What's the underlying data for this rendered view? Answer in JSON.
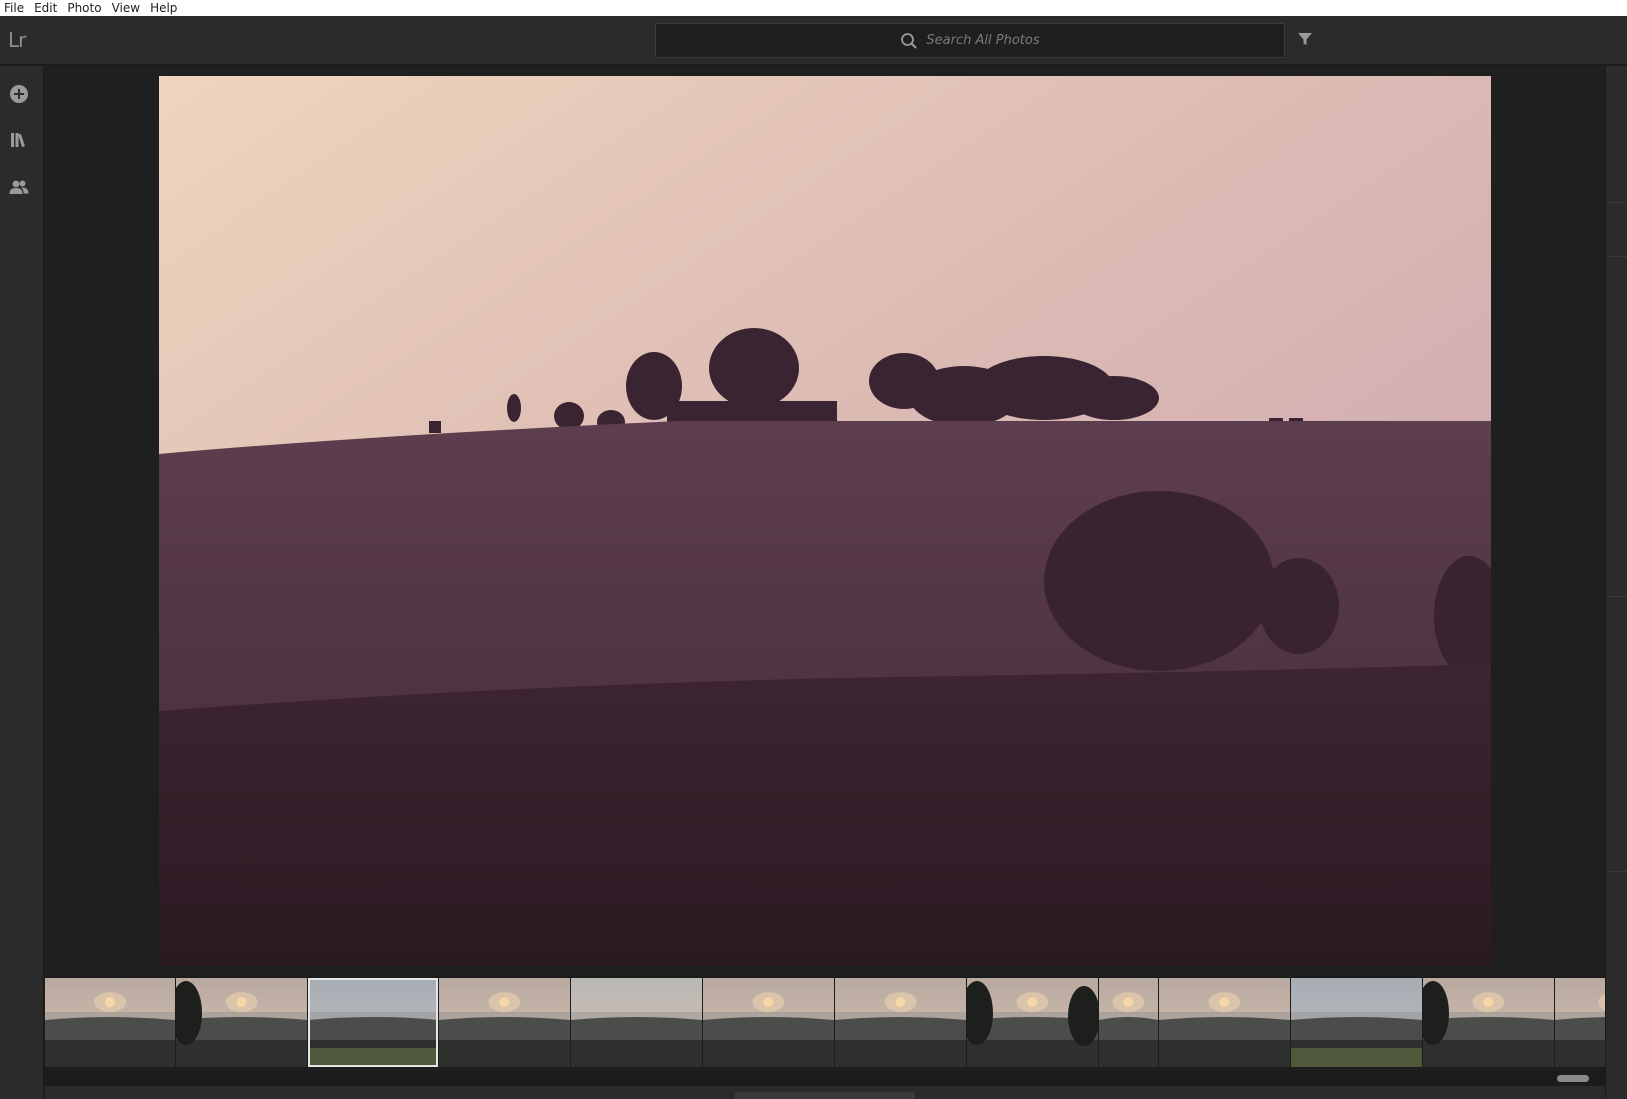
{
  "menu": {
    "items": [
      {
        "label": "File"
      },
      {
        "label": "Edit"
      },
      {
        "label": "Photo"
      },
      {
        "label": "View"
      },
      {
        "label": "Help"
      }
    ]
  },
  "app": {
    "logo": "Lr"
  },
  "search": {
    "placeholder": "Search All Photos",
    "icon": "search-icon"
  },
  "toolbar": {
    "filter_icon": "filter-icon"
  },
  "leftnav": {
    "icons": [
      "add-photos-icon",
      "library-icon",
      "shared-people-icon"
    ]
  },
  "filmstrip": {
    "count": 13,
    "selected_index": 2
  },
  "colors": {
    "accent_selection": "#e6e6e6",
    "chrome_bg": "#2b2b2b",
    "viewer_bg": "#1f1f1f"
  }
}
